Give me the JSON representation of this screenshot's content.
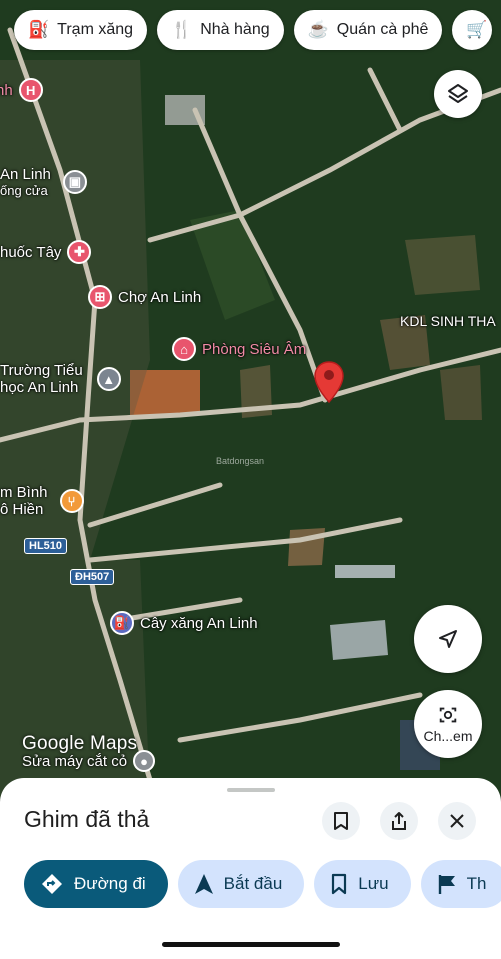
{
  "category_chips": [
    {
      "label": "Trạm xăng",
      "icon": "gas-station-icon"
    },
    {
      "label": "Nhà hàng",
      "icon": "restaurant-icon"
    },
    {
      "label": "Quán cà phê",
      "icon": "coffee-icon"
    },
    {
      "label": "",
      "icon": "shopping-cart-icon"
    }
  ],
  "places": {
    "hospital": {
      "label": "nh",
      "icon": "hospital-icon"
    },
    "an_linh": {
      "label": "An Linh",
      "sub": "ống cửa",
      "icon": "store-icon"
    },
    "pharmacy": {
      "label": "huốc Tây",
      "icon": "pharmacy-icon"
    },
    "market": {
      "label": "Chợ An Linh",
      "icon": "shopping-cart-icon"
    },
    "clinic": {
      "label": "Phòng Siêu Âm",
      "icon": "medical-icon"
    },
    "school": {
      "label": "Trường Tiểu",
      "sub": "học An Linh",
      "icon": "school-icon"
    },
    "food": {
      "label": "m Bình",
      "sub": "ô Hiền",
      "icon": "fork-knife-icon"
    },
    "gas": {
      "label": "Cây xăng An Linh",
      "icon": "gas-station-icon"
    },
    "eco": {
      "label": "KDL SINH THA"
    },
    "mower": {
      "label": "Sửa máy cắt cỏ"
    }
  },
  "roads": [
    "HL510",
    "ĐH507"
  ],
  "watermark": "Batdongsan",
  "wordmark": "Google Maps",
  "location_button_label": "Ch...em",
  "sheet": {
    "title": "Ghim đã thả",
    "actions": [
      {
        "label": "Đường đi",
        "icon": "directions-icon",
        "primary": true
      },
      {
        "label": "Bắt đầu",
        "icon": "navigation-arrow-icon"
      },
      {
        "label": "Lưu",
        "icon": "bookmark-icon"
      },
      {
        "label": "Th",
        "icon": "flag-icon"
      }
    ]
  },
  "colors": {
    "pin_red": "#d93025",
    "primary_button": "#0a5a7a",
    "chip_blue": "#d3e3fd"
  }
}
